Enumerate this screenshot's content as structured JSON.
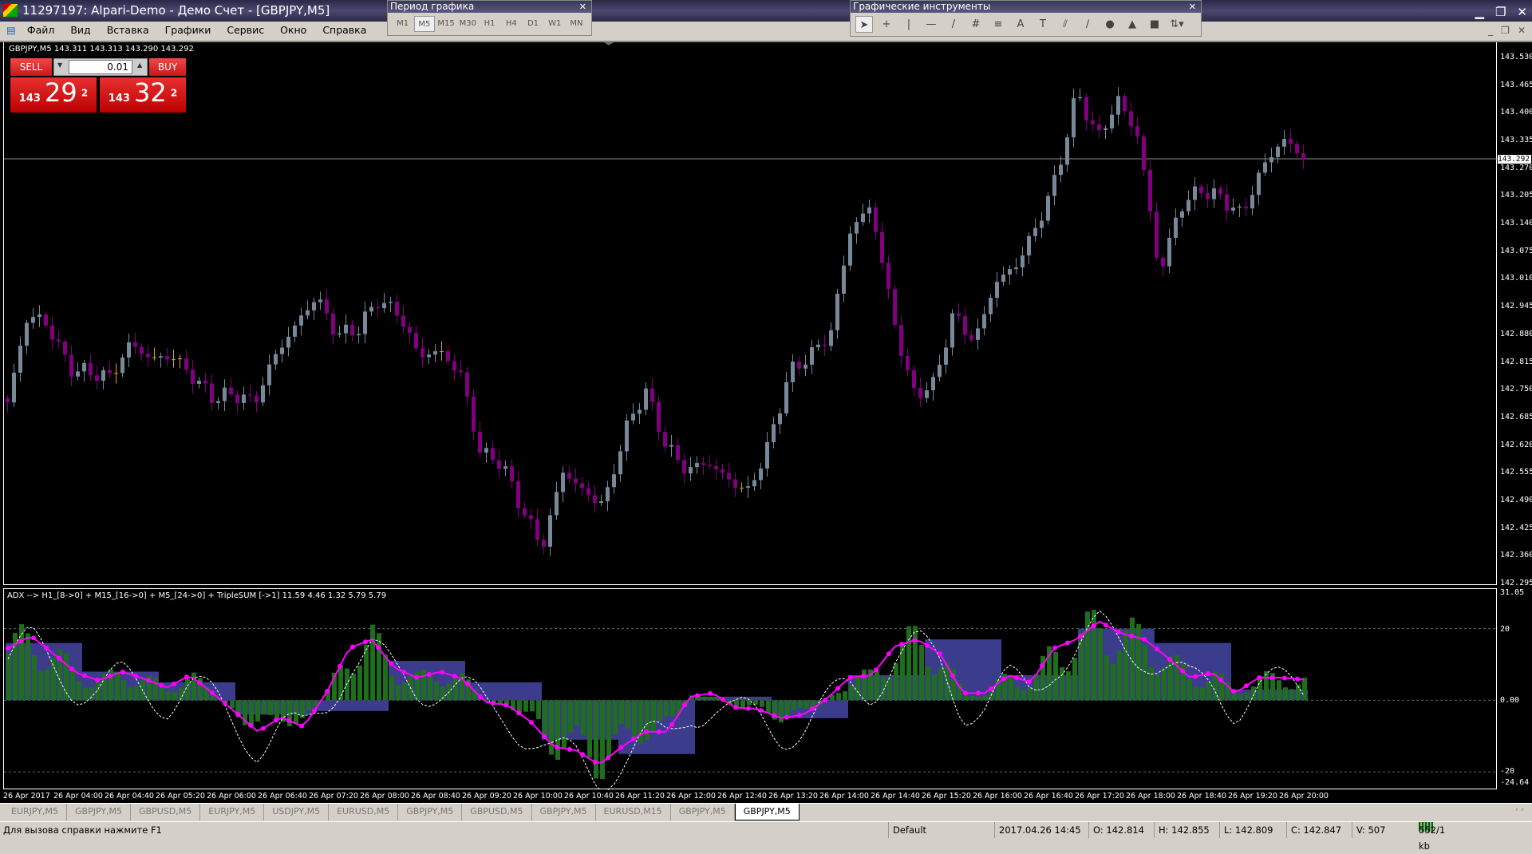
{
  "window": {
    "title": "11297197: Alpari-Demo - Демо Счет - [GBPJPY,M5]"
  },
  "menu": [
    "Файл",
    "Вид",
    "Вставка",
    "Графики",
    "Сервис",
    "Окно",
    "Справка"
  ],
  "period_toolbar": {
    "title": "Период графика",
    "buttons": [
      "M1",
      "M5",
      "M15",
      "M30",
      "H1",
      "H4",
      "D1",
      "W1",
      "MN"
    ],
    "active": "M5"
  },
  "tools_toolbar": {
    "title": "Графические инструменты",
    "tools": [
      {
        "icon": "cursor-icon",
        "glyph": "➤"
      },
      {
        "icon": "crosshair-icon",
        "glyph": "+"
      },
      {
        "icon": "vertical-line-icon",
        "glyph": "|"
      },
      {
        "icon": "horizontal-line-icon",
        "glyph": "—"
      },
      {
        "icon": "trendline-icon",
        "glyph": "/"
      },
      {
        "icon": "equidistant-channel-icon",
        "glyph": "#"
      },
      {
        "icon": "fibonacci-icon",
        "glyph": "≡"
      },
      {
        "icon": "text-icon",
        "glyph": "A"
      },
      {
        "icon": "text-label-icon",
        "glyph": "T"
      },
      {
        "icon": "gann-fan-icon",
        "glyph": "⫽"
      },
      {
        "icon": "gann-line-icon",
        "glyph": "∕"
      },
      {
        "icon": "ellipse-icon",
        "glyph": "●"
      },
      {
        "icon": "triangle-icon",
        "glyph": "▲"
      },
      {
        "icon": "rectangle-icon",
        "glyph": "■"
      },
      {
        "icon": "arrows-icon",
        "glyph": "⇅▾"
      }
    ]
  },
  "chart": {
    "header": "GBPJPY,M5  143.311 143.313 143.290 143.292",
    "trade": {
      "sell": "SELL",
      "buy": "BUY",
      "lot": "0.01",
      "bid_small": "143",
      "bid_big": "29",
      "bid_pip": "2",
      "ask_small": "143",
      "ask_big": "32",
      "ask_pip": "2"
    },
    "price_labels": [
      "143.530",
      "143.465",
      "143.400",
      "143.335",
      "143.270",
      "143.205",
      "143.140",
      "143.075",
      "143.010",
      "142.945",
      "142.880",
      "142.815",
      "142.750",
      "142.685",
      "142.620",
      "142.555",
      "142.490",
      "142.425",
      "142.360",
      "142.295"
    ],
    "current_price": "143.292",
    "colors": {
      "up": "#778899",
      "down": "#800080",
      "doji": "#d4a800",
      "grid": "#888888"
    },
    "close_trace": [
      142.72,
      142.93,
      142.9,
      142.8,
      142.79,
      142.78,
      142.86,
      142.82,
      142.83,
      142.78,
      142.73,
      142.74,
      142.72,
      142.83,
      142.9,
      142.97,
      142.88,
      142.89,
      142.96,
      142.93,
      142.83,
      142.84,
      142.79,
      142.6,
      142.58,
      142.47,
      142.38,
      142.56,
      142.51,
      142.48,
      142.65,
      142.75,
      142.62,
      142.56,
      142.58,
      142.54,
      142.51,
      142.62,
      142.79,
      142.83,
      142.88,
      143.13,
      143.18,
      142.93,
      142.74,
      142.76,
      142.93,
      142.86,
      143.0,
      143.04,
      143.13,
      143.25,
      143.45,
      143.34,
      143.43,
      143.34,
      143.02,
      143.18,
      143.22,
      143.2,
      143.16,
      143.27,
      143.34,
      143.292
    ]
  },
  "indicator": {
    "label": "ADX --> H1_[8->0] + M15_[16->0] + M5_[24->0] + TripleSUM [->1] 11.59 4.46 1.32 5.79 5.79",
    "axis_labels": {
      "max": "31.05",
      "l20": "20",
      "zero": "0.00",
      "m20": "-20",
      "min": "-24.64"
    },
    "range": [
      -24.64,
      31.05
    ],
    "levels": [
      20,
      0,
      -20
    ],
    "colors": {
      "line": "#ff00ff",
      "hist_a": "#3c3c8c",
      "hist_b": "#1e6e1e",
      "signal": "#ffffff"
    },
    "line_trace": [
      14.5,
      18,
      13,
      7.7,
      5.5,
      8,
      6,
      3.5,
      7,
      2,
      -3.3,
      -8.8,
      -4.7,
      -7.4,
      2,
      14.5,
      17,
      9,
      6.3,
      8,
      6,
      -0.5,
      -1.4,
      -6,
      -13,
      -14,
      -18,
      -13,
      -8.8,
      -8.8,
      1,
      2,
      -2,
      -2.5,
      -5,
      -4,
      0.3,
      6.3,
      7,
      15,
      17,
      13,
      2,
      2,
      7,
      5,
      14.5,
      17,
      22,
      18.6,
      17,
      12,
      6.3,
      7.7,
      2,
      6.3,
      6.3,
      5.79
    ]
  },
  "time_labels": [
    "26 Apr 2017",
    "26 Apr 04:00",
    "26 Apr 04:40",
    "26 Apr 05:20",
    "26 Apr 06:00",
    "26 Apr 06:40",
    "26 Apr 07:20",
    "26 Apr 08:00",
    "26 Apr 08:40",
    "26 Apr 09:20",
    "26 Apr 10:00",
    "26 Apr 10:40",
    "26 Apr 11:20",
    "26 Apr 12:00",
    "26 Apr 12:40",
    "26 Apr 13:20",
    "26 Apr 14:00",
    "26 Apr 14:40",
    "26 Apr 15:20",
    "26 Apr 16:00",
    "26 Apr 16:40",
    "26 Apr 17:20",
    "26 Apr 18:00",
    "26 Apr 18:40",
    "26 Apr 19:20",
    "26 Apr 20:00"
  ],
  "tabs": [
    "EURJPY,M5",
    "GBPJPY,M5",
    "GBPUSD,M5",
    "EURJPY,M5",
    "USDJPY,M5",
    "EURUSD,M5",
    "GBPJPY,M5",
    "GBPUSD,M5",
    "GBPJPY,M5",
    "EURUSD,M15",
    "GBPJPY,M5",
    "GBPJPY,M5"
  ],
  "active_tab": 11,
  "status": {
    "help": "Для вызова справки нажмите F1",
    "profile": "Default",
    "datetime": "2017.04.26 14:45",
    "open": "O: 142.814",
    "high": "H: 142.855",
    "low": "L: 142.809",
    "close": "C: 142.847",
    "volume": "V: 507",
    "traffic": "552/1 kb"
  }
}
